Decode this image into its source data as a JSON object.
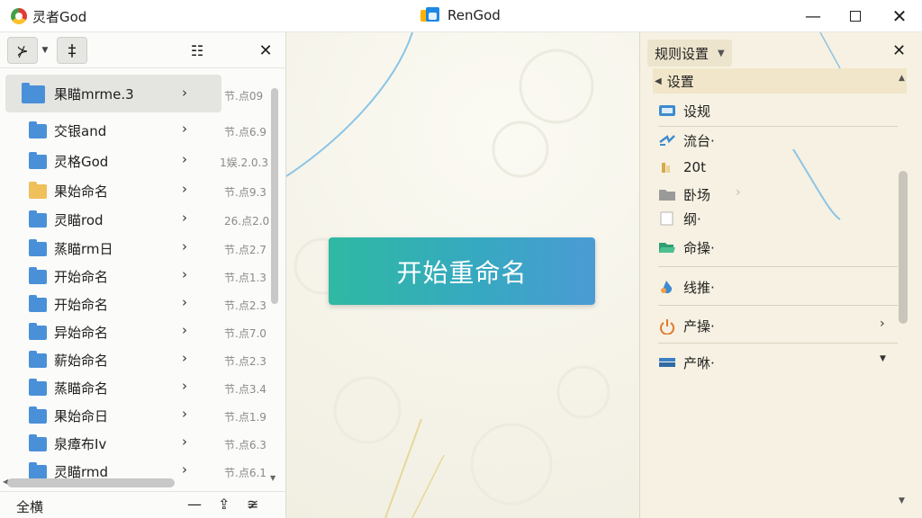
{
  "titlebar": {
    "app_name": "灵者God",
    "window_title": "RenGod",
    "min_glyph": "—",
    "close_glyph": "✕"
  },
  "left_toolbar": {
    "filter_glyph": "⊁",
    "pin_glyph": "‡",
    "view_glyph": "☷",
    "close_glyph": "✕"
  },
  "files": [
    {
      "name": "果瞄mrme.3",
      "date": "节.点09",
      "color": "blue"
    },
    {
      "name": "交银and",
      "date": "节.点6.9",
      "color": "blue"
    },
    {
      "name": "灵格God",
      "date": "1娱.2.0.3",
      "color": "blue"
    },
    {
      "name": "果始命名",
      "date": "节.点9.3",
      "color": "yellow"
    },
    {
      "name": "灵瞄rod",
      "date": "26.点2.0",
      "color": "blue"
    },
    {
      "name": "蒸瞄rm日",
      "date": "节.点2.7",
      "color": "blue"
    },
    {
      "name": "开始命名",
      "date": "节.点1.3",
      "color": "blue"
    },
    {
      "name": "开始命名",
      "date": "节.点2.3",
      "color": "blue"
    },
    {
      "name": "异始命名",
      "date": "节.点7.0",
      "color": "blue"
    },
    {
      "name": "薪始命名",
      "date": "节.点2.3",
      "color": "blue"
    },
    {
      "name": "蒸瞄命名",
      "date": "节.点3.4",
      "color": "blue"
    },
    {
      "name": "果始命日",
      "date": "节.点1.9",
      "color": "blue"
    },
    {
      "name": "泉瘴布Iv",
      "date": "节.点6.3",
      "color": "blue"
    },
    {
      "name": "灵瞄rmd",
      "date": "节.点6.1",
      "color": "blue"
    }
  ],
  "left_footer": {
    "label": "全横",
    "minus_glyph": "—",
    "sort_glyph": "⇪",
    "more_glyph": "≆"
  },
  "center": {
    "start_button": "开始重命名"
  },
  "right_panel": {
    "title": "规则设置",
    "close_glyph": "✕",
    "section": "设置",
    "items": [
      {
        "label": "设规",
        "icon": "card-icon"
      },
      {
        "label": "流台·",
        "icon": "arrows-icon"
      },
      {
        "label": "20t",
        "icon": "ruler-icon"
      },
      {
        "label": "卧场",
        "icon": "folder-icon"
      },
      {
        "label": "纲·",
        "icon": "page-icon"
      },
      {
        "label": "命操·",
        "icon": "folder-open-icon"
      },
      {
        "label": "线推·",
        "icon": "drop-icon"
      },
      {
        "label": "产操·",
        "icon": "power-icon"
      },
      {
        "label": "产咻·",
        "icon": "stack-icon"
      }
    ]
  },
  "colors": {
    "accent_start": "#2fb9a2",
    "accent_end": "#4a9bd4",
    "folder_blue": "#4a90d9",
    "folder_yellow": "#f0c05a"
  }
}
